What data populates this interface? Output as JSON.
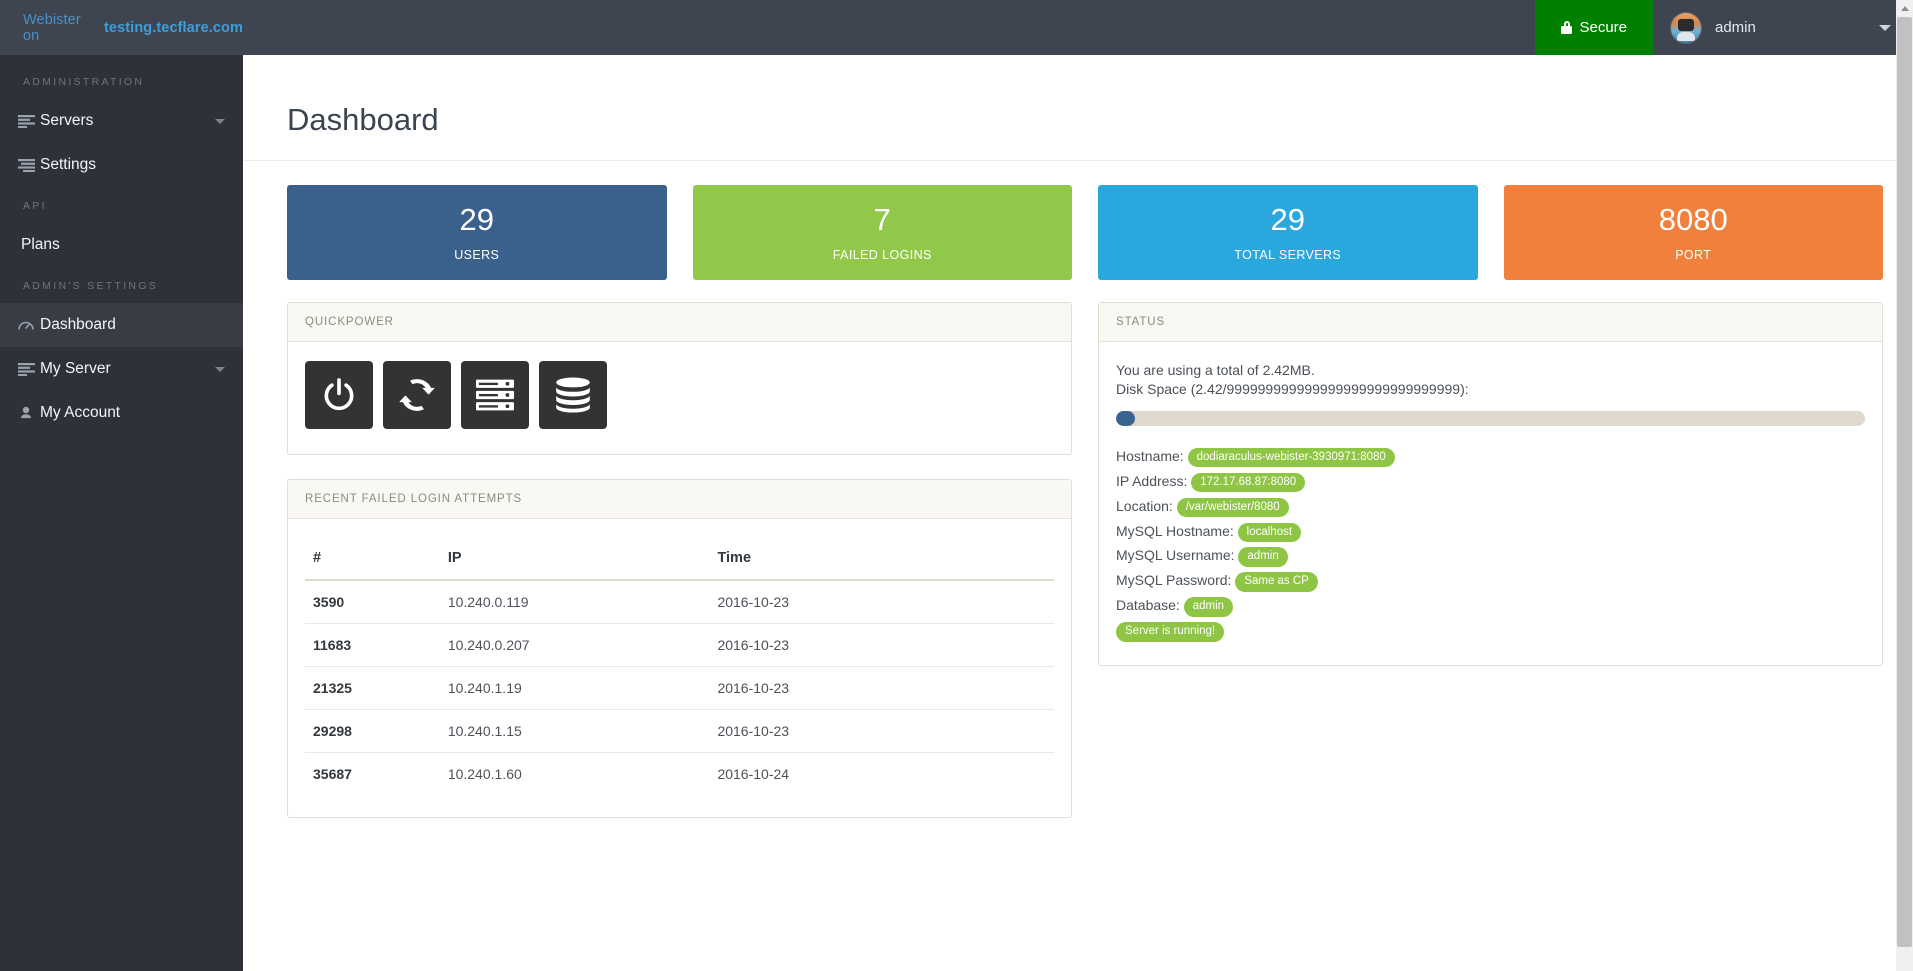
{
  "topbar": {
    "brand_prefix": "Webister on",
    "brand_domain": "testing.tecflare.com",
    "secure_label": "Secure",
    "user_name": "admin",
    "secure_color": "#008000",
    "bar_color": "#3e4551"
  },
  "sidebar": {
    "bg_color": "#2e3238",
    "groups": [
      {
        "title": "ADMINISTRATION"
      },
      {
        "title": "API"
      },
      {
        "title": "ADMIN'S SETTINGS"
      }
    ],
    "items": [
      {
        "label": "Servers",
        "icon": "server-list-icon",
        "expandable": true,
        "active": false
      },
      {
        "label": "Settings",
        "icon": "server-list-icon",
        "expandable": false,
        "active": false
      },
      {
        "label": "Plans",
        "icon": "none",
        "expandable": false,
        "active": false
      },
      {
        "label": "Dashboard",
        "icon": "dashboard-icon",
        "expandable": false,
        "active": true
      },
      {
        "label": "My Server",
        "icon": "server-list-icon",
        "expandable": true,
        "active": false
      },
      {
        "label": "My Account",
        "icon": "user-icon",
        "expandable": false,
        "active": false
      }
    ]
  },
  "page": {
    "title": "Dashboard"
  },
  "stats": [
    {
      "value": "29",
      "label": "USERS",
      "color": "#39618c"
    },
    {
      "value": "7",
      "label": "FAILED LOGINS",
      "color": "#91c84a"
    },
    {
      "value": "29",
      "label": "TOTAL SERVERS",
      "color": "#2aa8dd"
    },
    {
      "value": "8080",
      "label": "PORT",
      "color": "#f0803c"
    }
  ],
  "quickpower": {
    "title": "QUICKPOWER",
    "buttons": [
      {
        "icon": "power-icon",
        "name": "power-button"
      },
      {
        "icon": "refresh-icon",
        "name": "restart-button"
      },
      {
        "icon": "server-icon",
        "name": "server-button"
      },
      {
        "icon": "database-icon",
        "name": "database-button"
      }
    ]
  },
  "status": {
    "title": "STATUS",
    "usage_text": "You are using a total of 2.42MB.",
    "disk_label": "Disk Space (2.42/999999999999999999999999999999):",
    "progress_percent": 2.5,
    "progress_fill_color": "#3b6391",
    "progress_track_color": "#ded8cd",
    "badge_color": "#8fc544",
    "fields": [
      {
        "label": "Hostname:",
        "value": "dodiaraculus-webister-3930971:8080"
      },
      {
        "label": "IP Address:",
        "value": "172.17.68.87:8080"
      },
      {
        "label": "Location:",
        "value": "/var/webister/8080"
      },
      {
        "label": "MySQL Hostname:",
        "value": "localhost"
      },
      {
        "label": "MySQL Username:",
        "value": "admin"
      },
      {
        "label": "MySQL Password:",
        "value": "Same as CP"
      },
      {
        "label": "Database:",
        "value": "admin"
      }
    ],
    "running_badge": "Server is running!"
  },
  "failed_logins": {
    "title": "RECENT FAILED LOGIN ATTEMPTS",
    "columns": [
      "#",
      "IP",
      "Time"
    ],
    "rows": [
      {
        "id": "3590",
        "ip": "10.240.0.119",
        "time": "2016-10-23"
      },
      {
        "id": "11683",
        "ip": "10.240.0.207",
        "time": "2016-10-23"
      },
      {
        "id": "21325",
        "ip": "10.240.1.19",
        "time": "2016-10-23"
      },
      {
        "id": "29298",
        "ip": "10.240.1.15",
        "time": "2016-10-23"
      },
      {
        "id": "35687",
        "ip": "10.240.1.60",
        "time": "2016-10-24"
      }
    ]
  }
}
